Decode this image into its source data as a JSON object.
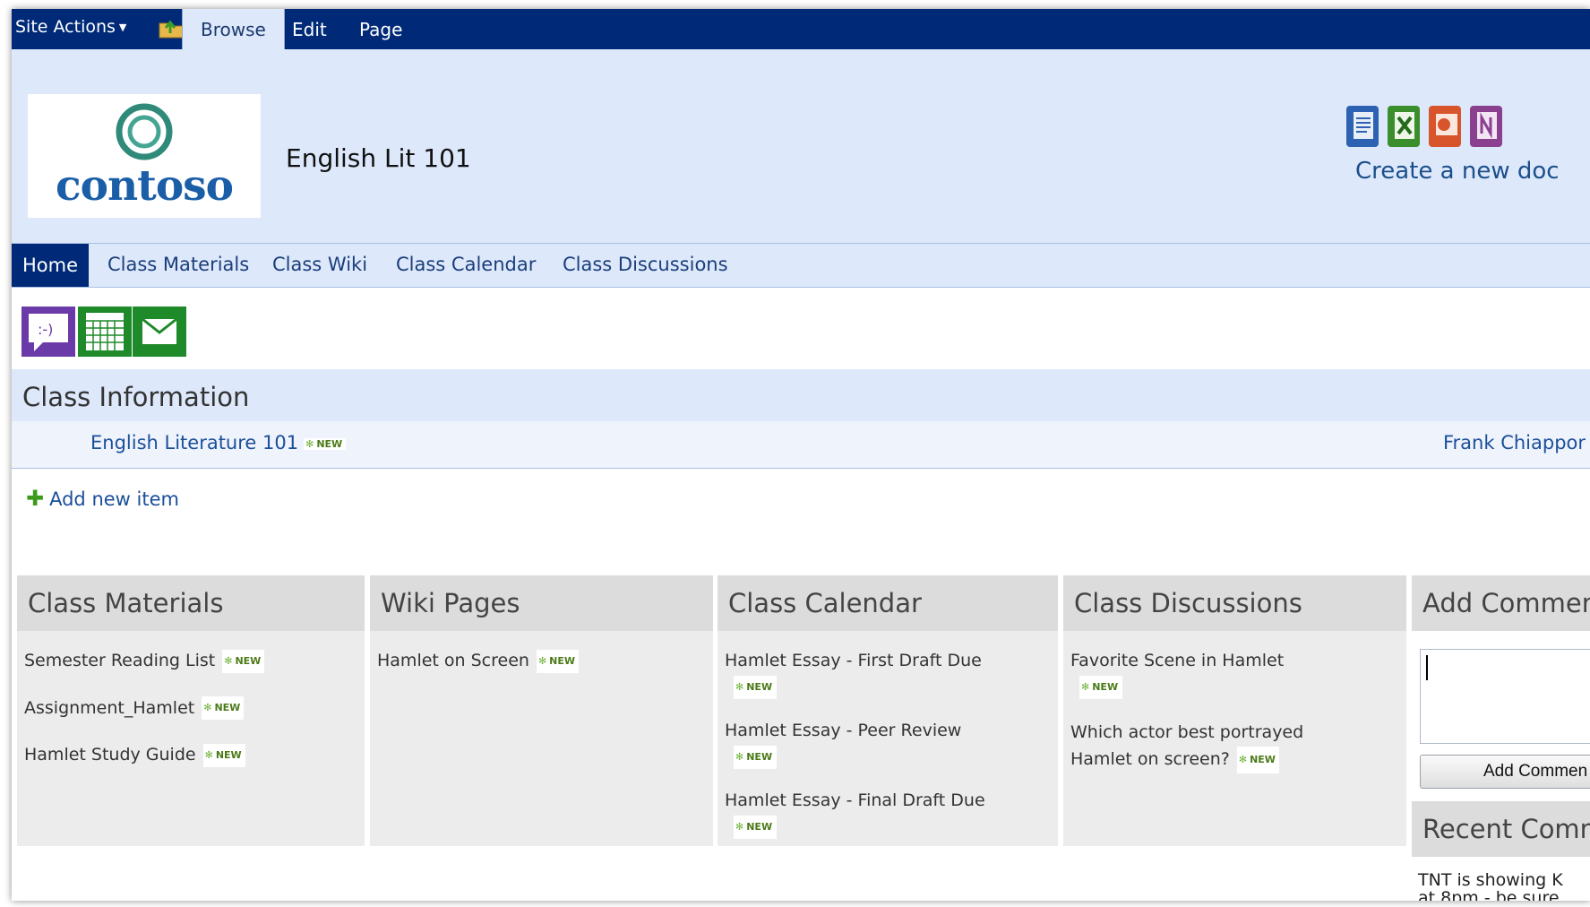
{
  "ribbon": {
    "site_actions": "Site Actions",
    "tabs": [
      "Browse",
      "Edit",
      "Page"
    ]
  },
  "header": {
    "logo_text": "contoso",
    "site_title": "English Lit 101",
    "create_doc": "Create a new doc",
    "doc_icons": [
      "word-icon",
      "excel-icon",
      "powerpoint-icon",
      "onenote-icon"
    ]
  },
  "topnav": {
    "items": [
      "Home",
      "Class Materials",
      "Class Wiki",
      "Class Calendar",
      "Class Discussions"
    ]
  },
  "quick_icons": [
    "chat-icon",
    "calendar-icon",
    "mail-icon"
  ],
  "class_info": {
    "title": "Class Information",
    "item": "English Literature 101",
    "person": "Frank Chiappor",
    "add_new_item": "Add new item"
  },
  "new_tag": "NEW",
  "webparts": {
    "materials": {
      "title": "Class Materials",
      "items": [
        "Semester Reading List",
        "Assignment_Hamlet",
        "Hamlet Study Guide"
      ]
    },
    "wiki": {
      "title": "Wiki Pages",
      "items": [
        "Hamlet on Screen"
      ]
    },
    "calendar": {
      "title": "Class Calendar",
      "items": [
        "Hamlet Essay - First Draft Due",
        "Hamlet Essay - Peer Review",
        "Hamlet Essay - Final Draft Due"
      ]
    },
    "discussions": {
      "title": "Class Discussions",
      "item1": "Favorite Scene in Hamlet",
      "item2_line1": "Which actor best portrayed",
      "item2_line2": "Hamlet on screen?"
    }
  },
  "comments": {
    "title": "Add Commen",
    "button": "Add Commen",
    "recent_title": "Recent Comm",
    "recent_line1": "TNT is showing K",
    "recent_line2": "at 8pm  - be sure"
  },
  "colors": {
    "ribbon": "#002a78",
    "header_bg": "#dde8fb",
    "link": "#1b4f9a",
    "webpart_bg": "#ececec"
  }
}
